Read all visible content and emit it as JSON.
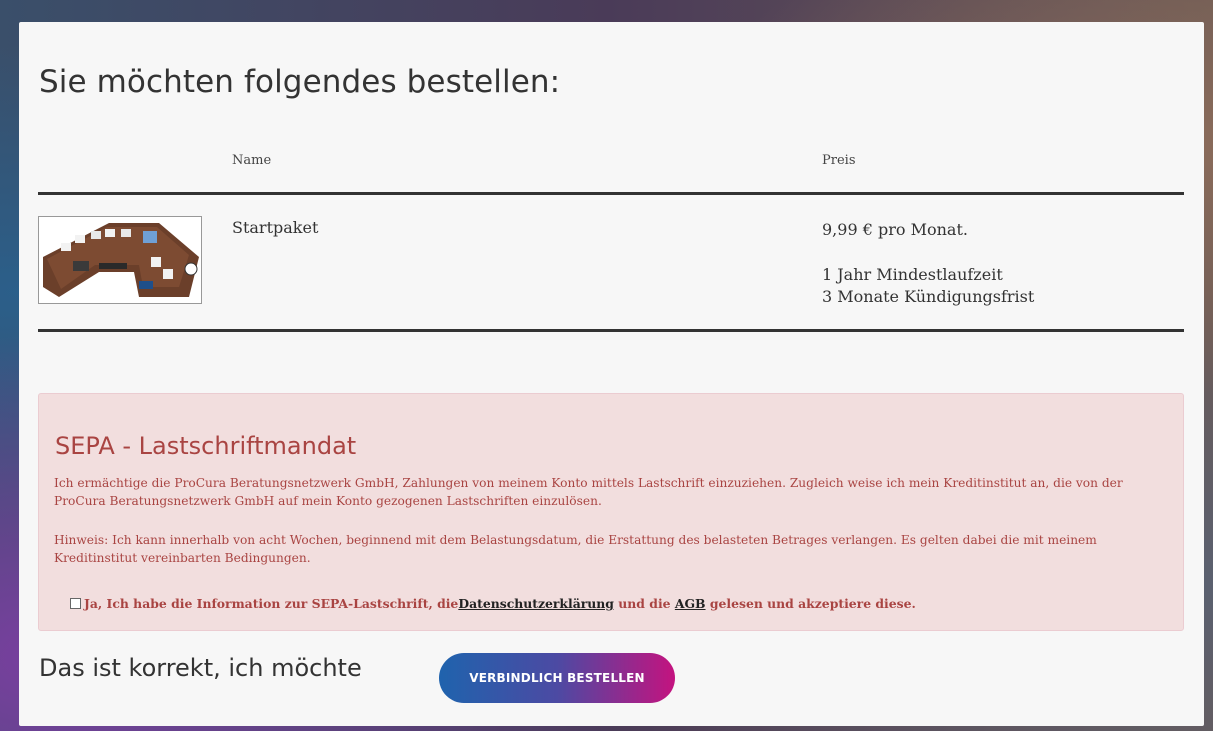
{
  "heading": "Sie möchten folgendes bestellen:",
  "table": {
    "columns": {
      "name": "Name",
      "price": "Preis"
    },
    "row": {
      "product_name": "Startpaket",
      "price": "9,99 € pro Monat.",
      "term": "1 Jahr Mindestlaufzeit",
      "cancellation": "3 Monate Kündigungsfrist"
    }
  },
  "sepa": {
    "title": "SEPA - Lastschriftmandat",
    "paragraph1": "Ich ermächtige die ProCura Beratungsnetzwerk GmbH, Zahlungen von meinem Konto mittels Lastschrift einzuziehen. Zugleich weise ich mein Kreditinstitut an, die von der ProCura Beratungsnetzwerk GmbH auf mein Konto gezogenen Lastschriften einzulösen.",
    "paragraph2": "Hinweis: Ich kann innerhalb von acht Wochen, beginnend mit dem Belastungsdatum, die Erstattung des belasteten Betrages verlangen. Es gelten dabei die mit meinem Kreditinstitut vereinbarten Bedingungen.",
    "consent": {
      "text_before": "Ja, Ich habe die Information zur SEPA-Lastschrift, die ",
      "privacy_link": "Datenschutzerklärung",
      "text_middle": " und die ",
      "agb_link": "AGB",
      "text_after": " gelesen und akzeptiere diese.",
      "checked": false
    }
  },
  "confirm": {
    "text": "Das ist korrekt, ich möchte",
    "button_label": "VERBINDLICH BESTELLEN"
  },
  "colors": {
    "alert_bg": "#f2dede",
    "alert_text": "#a94442",
    "button_start": "#1f63ad",
    "button_end": "#c4137f"
  }
}
